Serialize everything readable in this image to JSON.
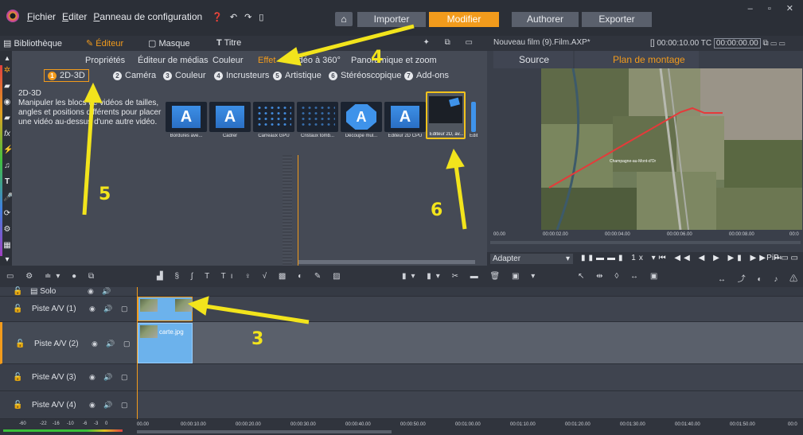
{
  "menu": {
    "items": [
      "Fichier",
      "Editer",
      "Panneau de configuration"
    ],
    "mode_tabs": [
      "Importer",
      "Modifier",
      "Authorer",
      "Exporter"
    ],
    "active_mode": "Modifier"
  },
  "library_panel": {
    "tabs": [
      "Bibliothèque",
      "Éditeur",
      "Masque",
      "Titre"
    ],
    "active_tab": "Éditeur"
  },
  "editor": {
    "sub_tabs": [
      "Propriétés",
      "Éditeur de médias",
      "Couleur",
      "Effet",
      "Vidéo à 360°",
      "Panoramique et zoom"
    ],
    "active_sub_tab": "Effet",
    "categories": [
      {
        "num": "1",
        "label": "2D-3D"
      },
      {
        "num": "2",
        "label": "Caméra"
      },
      {
        "num": "3",
        "label": "Couleur"
      },
      {
        "num": "4",
        "label": "Incrusteurs"
      },
      {
        "num": "5",
        "label": "Artistique"
      },
      {
        "num": "6",
        "label": "Stéréoscopique"
      },
      {
        "num": "7",
        "label": "Add-ons"
      }
    ],
    "active_category": "2D-3D",
    "description_title": "2D-3D",
    "description": "Manipuler les blocs de vidéos de tailles, angles et positions différents pour placer une vidéo au-dessus d'une autre vidéo.",
    "effects": [
      {
        "label": "Bordures ave...",
        "icon": "a-box"
      },
      {
        "label": "Cadrer",
        "icon": "a-box"
      },
      {
        "label": "Carreaux GPU",
        "icon": "cubes"
      },
      {
        "label": "Cristaux tomb...",
        "icon": "cubes"
      },
      {
        "label": "Découpe mul...",
        "icon": "a-oct"
      },
      {
        "label": "Editeur 2D CPU",
        "icon": "a-box"
      },
      {
        "label": "Éditeur 2D, av...",
        "icon": "tile"
      },
      {
        "label": "Édit",
        "icon": "partial"
      }
    ],
    "selected_effect": "Éditeur 2D, av..."
  },
  "preview": {
    "title": "Nouveau film (9).Film.AXP*",
    "duration": "00:00:10.00",
    "tc_label": "TC",
    "timecode": "00:00:00.00",
    "tabs": [
      "Source",
      "Plan de montage"
    ],
    "active_tab": "Plan de montage",
    "ruler_labels": [
      "00.00",
      "00:00:02.00",
      "00:00:04.00",
      "00:00:06.00",
      "00:00:08.00",
      "00:0"
    ],
    "fit_option": "Adapter",
    "speed": "1x",
    "pip_label": "PiP",
    "map_label": "Champagne-au-Mont-d'Or"
  },
  "timeline": {
    "solo_label": "Solo",
    "tracks": [
      {
        "name": "Piste A/V (1)"
      },
      {
        "name": "Piste A/V (2)"
      },
      {
        "name": "Piste A/V (3)"
      },
      {
        "name": "Piste A/V (4)"
      }
    ],
    "clip_label": "carte.jpg",
    "vu_labels": [
      "-60",
      "-22",
      "-16",
      "-10",
      "-6",
      "-3",
      "0"
    ],
    "ruler_labels": [
      "00.00",
      "00:00:10.00",
      "00:00:20.00",
      "00:00:30.00",
      "00:00:40.00",
      "00:00:50.00",
      "00:01:00.00",
      "00:01:10.00",
      "00:01:20.00",
      "00:01:30.00",
      "00:01:40.00",
      "00:01:50.00",
      "00:0"
    ]
  },
  "annotations": [
    "4",
    "5",
    "6",
    "3"
  ],
  "colors": {
    "accent": "#f29b1c",
    "annotation": "#f2e41c",
    "clip": "#6cb2ec"
  }
}
